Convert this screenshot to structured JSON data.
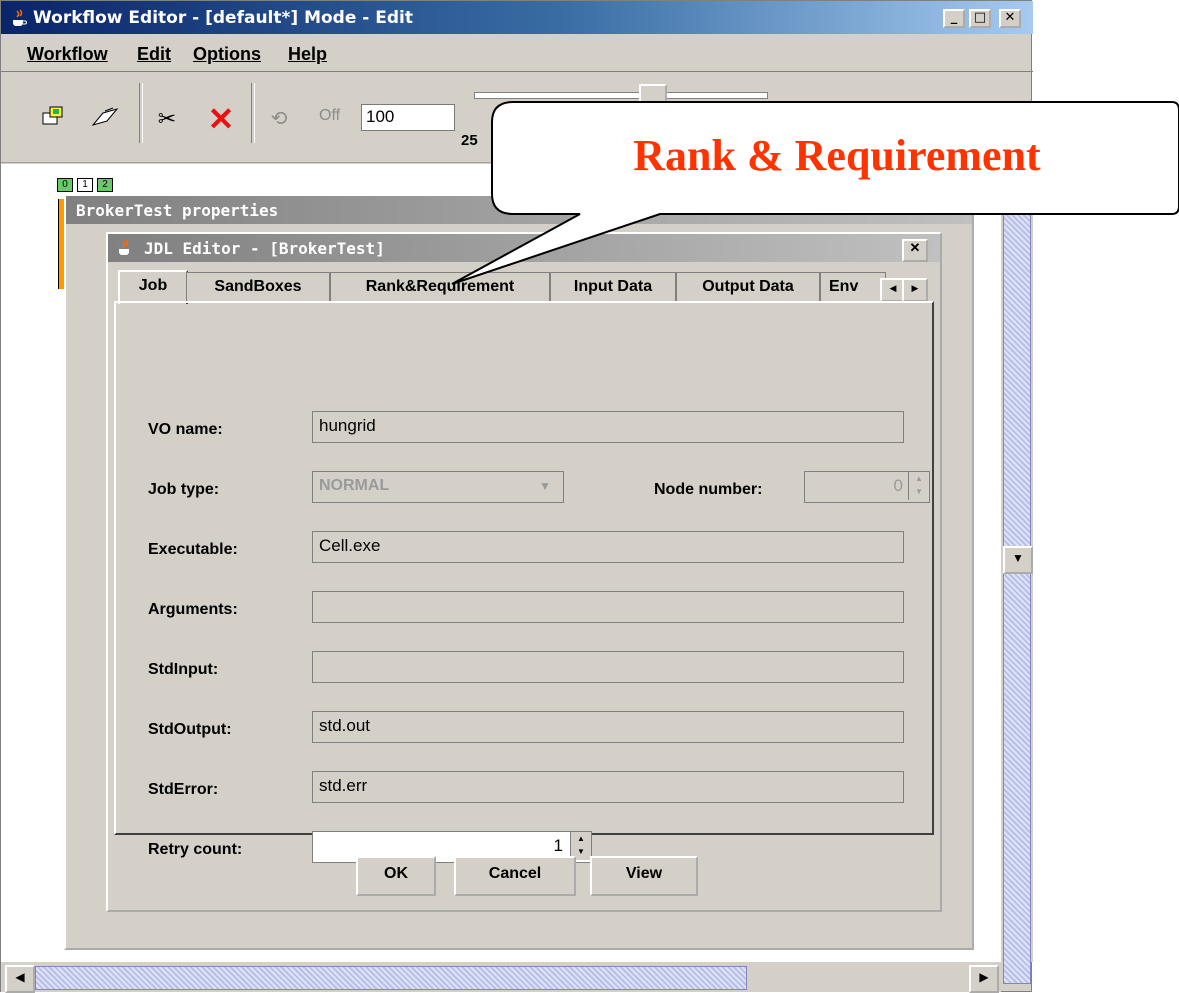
{
  "window": {
    "title": "Workflow Editor - [default*] Mode - Edit",
    "min_glyph": "_",
    "max_glyph": "□",
    "close_glyph": "✕"
  },
  "menu": [
    "Workflow",
    "Edit",
    "Options",
    "Help"
  ],
  "toolbar": {
    "off_label": "Off",
    "zoom_value": "100",
    "slider_tick": "25",
    "icons": [
      "open-icon",
      "save-icon",
      "cut-icon",
      "delete-icon",
      "refresh-icon"
    ]
  },
  "canvas": {
    "node_labels": [
      "0",
      "1",
      "2"
    ]
  },
  "properties": {
    "title": "BrokerTest properties"
  },
  "jdl": {
    "title": "JDL Editor - [BrokerTest]",
    "close_glyph": "✕",
    "tabs": [
      "Job",
      "SandBoxes",
      "Rank&Requirement",
      "Input Data",
      "Output Data",
      "Env"
    ],
    "fields": {
      "vo_name_label": "VO name:",
      "vo_name_value": "hungrid",
      "job_type_label": "Job type:",
      "job_type_value": "NORMAL",
      "node_number_label": "Node number:",
      "node_number_value": "0",
      "executable_label": "Executable:",
      "executable_value": "Cell.exe",
      "arguments_label": "Arguments:",
      "arguments_value": "",
      "stdinput_label": "StdInput:",
      "stdinput_value": "",
      "stdoutput_label": "StdOutput:",
      "stdoutput_value": "std.out",
      "stderror_label": "StdError:",
      "stderror_value": "std.err",
      "retry_label": "Retry count:",
      "retry_value": "1"
    },
    "buttons": {
      "ok": "OK",
      "cancel": "Cancel",
      "view": "View"
    }
  },
  "callout": {
    "text": "Rank & Requirement",
    "color": "#ff3300"
  },
  "colors": {
    "title_active": "#0a246a",
    "window_bg": "#d4d0c8",
    "scroll_thumb": "#b8bfe6"
  }
}
